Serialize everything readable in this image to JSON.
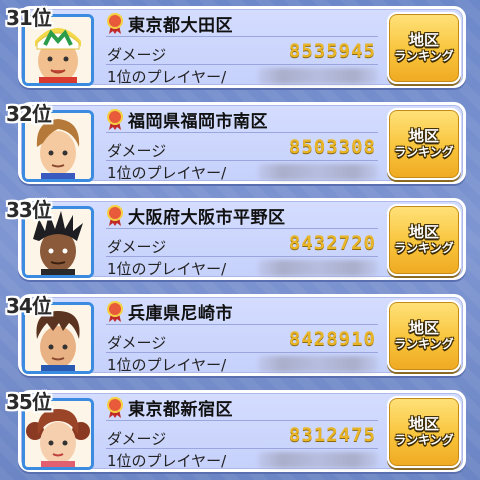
{
  "labels": {
    "damage": "ダメージ",
    "top_player": "1位のプレイヤー/",
    "button_line1": "地区",
    "button_line2": "ランキング"
  },
  "entries": [
    {
      "rank": "31位",
      "region": "東京都大田区",
      "damage": "8535945",
      "avatar": "boy-cap-icon"
    },
    {
      "rank": "32位",
      "region": "福岡県福岡市南区",
      "damage": "8503308",
      "avatar": "boy-brown-hair-icon"
    },
    {
      "rank": "33位",
      "region": "大阪府大阪市平野区",
      "damage": "8432720",
      "avatar": "boy-spiky-hair-icon"
    },
    {
      "rank": "34位",
      "region": "兵庫県尼崎市",
      "damage": "8428910",
      "avatar": "boy-short-hair-icon"
    },
    {
      "rank": "35位",
      "region": "東京都新宿区",
      "damage": "8312475",
      "avatar": "girl-pigtails-icon"
    }
  ],
  "colors": {
    "background": "#7089c8",
    "card": "#cdd7fd",
    "damage_value": "#e8b428",
    "button": "#f8c43c",
    "avatar_border": "#3b8be0",
    "ribbon": "#d43a2a"
  }
}
